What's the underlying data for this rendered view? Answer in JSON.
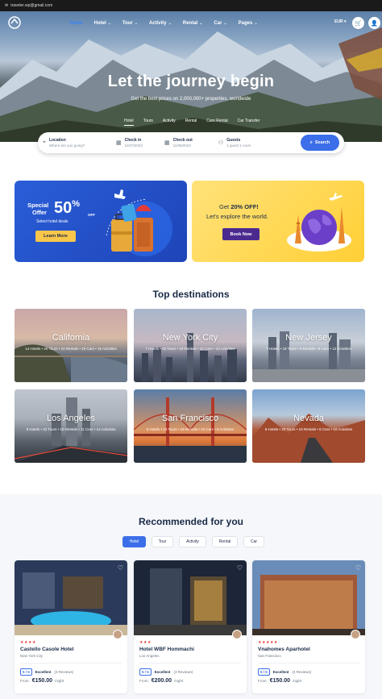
{
  "topbar": {
    "email": "traveler.wp@gmail.com"
  },
  "nav": {
    "menu": [
      {
        "label": "Home",
        "chevron": false,
        "active": true
      },
      {
        "label": "Hotel",
        "chevron": true
      },
      {
        "label": "Tour",
        "chevron": true
      },
      {
        "label": "Activity",
        "chevron": true
      },
      {
        "label": "Rental",
        "chevron": true
      },
      {
        "label": "Car",
        "chevron": true
      },
      {
        "label": "Pages",
        "chevron": true
      }
    ],
    "currency": "EUR",
    "currency_chevron": "▾",
    "icons": {
      "cart": "cart-icon",
      "user": "user-icon",
      "logo": "logo-icon"
    }
  },
  "hero": {
    "title": "Let the journey begin",
    "subtitle": "Get the best prices on 2,000,000+ properties, worldwide",
    "tabs": [
      "Hotel",
      "Tours",
      "Activity",
      "Rental",
      "Cars Rental",
      "Car Transfer"
    ],
    "active_tab": "Hotel"
  },
  "search": {
    "location_label": "Location",
    "location_placeholder": "Where are you going?",
    "checkin_label": "Check in",
    "checkin_value": "11/07/2023",
    "checkout_label": "Check out",
    "checkout_value": "11/08/2023",
    "guests_label": "Guests",
    "guests_value": "1 guest 1 room",
    "button": "Search"
  },
  "promos": {
    "p1": {
      "line1": "Special",
      "line2": "Offer",
      "big": "50",
      "pct": "%",
      "off": "OFF",
      "sub": "Select hotel deals",
      "button": "Learn More"
    },
    "p2": {
      "line1_pre": "Get ",
      "line1_bold": "20% OFF!",
      "line2": "Let's explore the world.",
      "button": "Book Now"
    }
  },
  "destinations": {
    "title": "Top destinations",
    "items": [
      {
        "name": "California",
        "stats": "14 Hotels • 20 Tours • 22 Rentals • 19 Cars • 15 Activities"
      },
      {
        "name": "New York City",
        "stats": "7 Hotels • 15 Tours • 18 Rentals • 22 Cars • 10 Activities"
      },
      {
        "name": "New Jersey",
        "stats": "7 Hotels • 18 Tours • 8 Rentals • 8 Cars • 12 Activities"
      },
      {
        "name": "Los Angeles",
        "stats": "8 Hotels • 22 Tours • 10 Rentals • 11 Cars • 14 Activities"
      },
      {
        "name": "San Francisco",
        "stats": "8 Hotels • 13 Tours • 18 Rentals • 16 Cars • 8 Activities"
      },
      {
        "name": "Nevada",
        "stats": "8 Hotels • 20 Tours • 10 Rentals • 8 Cars • 10 Activities"
      }
    ]
  },
  "recommended": {
    "title": "Recommended for you",
    "tabs": [
      "Hotel",
      "Tour",
      "Activity",
      "Rental",
      "Car"
    ],
    "cards": [
      {
        "stars": "★★★★",
        "name": "Castello Casole Hotel",
        "location": "New York City",
        "score": "5 / 5",
        "rating": "Excellent",
        "reviews": "(3 Reviews)",
        "from": "From:",
        "price": "€150.00",
        "unit": "/night"
      },
      {
        "stars": "★★★",
        "name": "Hotel WBF Hommachi",
        "location": "Los Angeles",
        "score": "5 / 5",
        "rating": "Excellent",
        "reviews": "(3 Reviews)",
        "from": "From:",
        "price": "€200.00",
        "unit": "/night"
      },
      {
        "stars": "★★★★★",
        "name": "Vnahomes Aparhotel",
        "location": "San Francisco",
        "score": "5 / 5",
        "rating": "Excellent",
        "reviews": "(4 Reviews)",
        "from": "From:",
        "price": "€150.00",
        "unit": "/night"
      }
    ]
  },
  "colors": {
    "accent": "#3b6ee8",
    "navy": "#1a2b48",
    "yellow": "#f7c64a",
    "purple": "#4b2a8f"
  }
}
